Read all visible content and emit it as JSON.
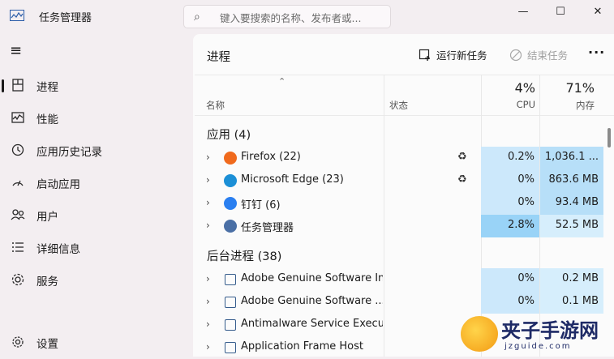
{
  "window": {
    "title": "任务管理器",
    "search_placeholder": "键入要搜索的名称、发布者或...",
    "controls": {
      "minimize": "—",
      "maximize": "☐",
      "close": "✕"
    }
  },
  "sidebar": {
    "hamburger": "≡",
    "items": [
      {
        "label": "进程",
        "icon": "processes-icon"
      },
      {
        "label": "性能",
        "icon": "performance-icon"
      },
      {
        "label": "应用历史记录",
        "icon": "history-icon"
      },
      {
        "label": "启动应用",
        "icon": "startup-icon"
      },
      {
        "label": "用户",
        "icon": "users-icon"
      },
      {
        "label": "详细信息",
        "icon": "details-icon"
      },
      {
        "label": "服务",
        "icon": "services-icon"
      }
    ],
    "settings_label": "设置"
  },
  "main": {
    "title": "进程",
    "run_new_task": "运行新任务",
    "end_task": "结束任务",
    "more": "···"
  },
  "columns": {
    "name": "名称",
    "status": "状态",
    "cpu_pct": "4%",
    "cpu": "CPU",
    "mem_pct": "71%",
    "mem": "内存"
  },
  "groups": {
    "apps": "应用 (4)",
    "background": "后台进程 (38)"
  },
  "apps": [
    {
      "name": "Firefox (22)",
      "cpu": "0.2%",
      "mem": "1,036.1 ...",
      "efficiency": true,
      "color": "#f06a1d"
    },
    {
      "name": "Microsoft Edge (23)",
      "cpu": "0%",
      "mem": "863.6 MB",
      "efficiency": true,
      "color": "#1b8fd6"
    },
    {
      "name": "钉钉 (6)",
      "cpu": "0%",
      "mem": "93.4 MB",
      "efficiency": false,
      "color": "#2a7ff0"
    },
    {
      "name": "任务管理器",
      "cpu": "2.8%",
      "mem": "52.5 MB",
      "efficiency": false,
      "color": "#4a6fa5"
    }
  ],
  "background": [
    {
      "name": "Adobe Genuine Software In...",
      "cpu": "0%",
      "mem": "0.2 MB"
    },
    {
      "name": "Adobe Genuine Software ...",
      "cpu": "0%",
      "mem": "0.1 MB"
    },
    {
      "name": "Antimalware Service Execut...",
      "cpu": "",
      "mem": ""
    },
    {
      "name": "Application Frame Host",
      "cpu": "",
      "mem": ""
    }
  ],
  "watermark": {
    "big": "夹子手游网",
    "small": "jzguide.com"
  },
  "colors": {
    "cpu_light": "#cce8fb",
    "cpu_dark": "#99d3f7",
    "mem_mid": "#b7dff8",
    "mem_light": "#d6eefc"
  }
}
